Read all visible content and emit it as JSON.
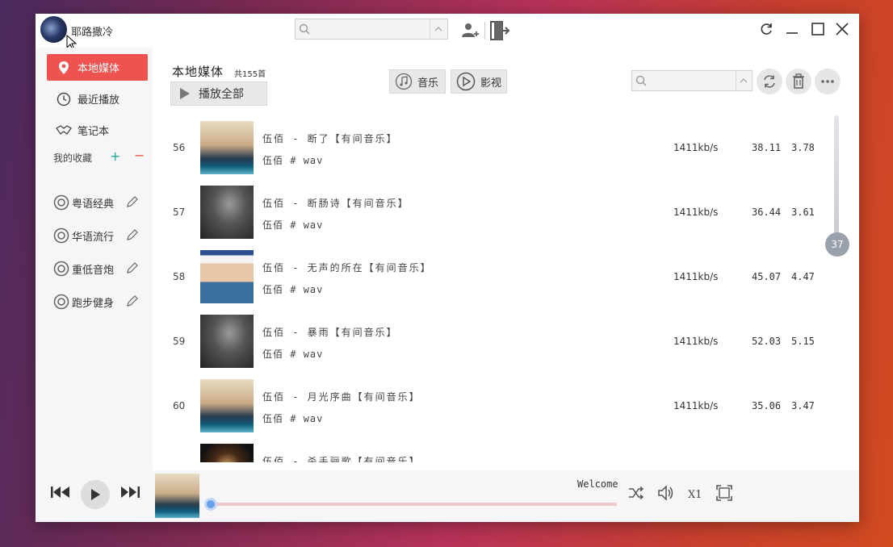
{
  "window": {
    "user": {
      "name": "耶路撒冷"
    },
    "controls": [
      "refresh",
      "minimize",
      "maximize",
      "close"
    ]
  },
  "sidebar": {
    "items": [
      {
        "label": "本地媒体",
        "icon": "location-pin-icon",
        "active": true
      },
      {
        "label": "最近播放",
        "icon": "clock-icon",
        "active": false
      },
      {
        "label": "笔记本",
        "icon": "handshake-icon",
        "active": false
      }
    ],
    "favorites_label": "我的收藏",
    "favorites": [
      {
        "label": "粤语经典"
      },
      {
        "label": "华语流行"
      },
      {
        "label": "重低音炮"
      },
      {
        "label": "跑步健身"
      }
    ]
  },
  "main": {
    "title": "本地媒体",
    "count": "共155首",
    "play_all": "播放全部",
    "tabs": [
      {
        "label": "音乐",
        "icon": "music-note-icon"
      },
      {
        "label": "影视",
        "icon": "play-circle-icon"
      }
    ],
    "actions": [
      "refresh-icon",
      "trash-icon",
      "more-icon"
    ]
  },
  "songs": [
    {
      "num": "56",
      "title": "伍佰 - 断了【有间音乐】",
      "artist": "伍佰 # wav",
      "bitrate": "1411kb/s",
      "duration": "38.11",
      "size": "3.78",
      "cover": "turntable"
    },
    {
      "num": "57",
      "title": "伍佰 - 断肠诗【有间音乐】",
      "artist": "伍佰 # wav",
      "bitrate": "1411kb/s",
      "duration": "36.44",
      "size": "3.61",
      "cover": "silhouette"
    },
    {
      "num": "58",
      "title": "伍佰 - 无声的所在【有间音乐】",
      "artist": "伍佰 # wav",
      "bitrate": "1411kb/s",
      "duration": "45.07",
      "size": "4.47",
      "cover": "portrait"
    },
    {
      "num": "59",
      "title": "伍佰 - 暴雨【有间音乐】",
      "artist": "伍佰 # wav",
      "bitrate": "1411kb/s",
      "duration": "52.03",
      "size": "5.15",
      "cover": "silhouette"
    },
    {
      "num": "60",
      "title": "伍佰 - 月光序曲【有间音乐】",
      "artist": "伍佰 # wav",
      "bitrate": "1411kb/s",
      "duration": "35.06",
      "size": "3.47",
      "cover": "turntable"
    },
    {
      "num": "",
      "title": "伍佰 - 杀手骊歌【有间音乐】",
      "artist": "",
      "bitrate": "",
      "duration": "",
      "size": "",
      "cover": "dark"
    }
  ],
  "scrollbar": {
    "badge": "37"
  },
  "player": {
    "now_playing": "Welcome",
    "speed": "X1",
    "progress": 0.0,
    "controls": [
      "previous-icon",
      "play-icon",
      "next-icon",
      "shuffle-icon",
      "volume-icon",
      "fullscreen-icon"
    ]
  }
}
